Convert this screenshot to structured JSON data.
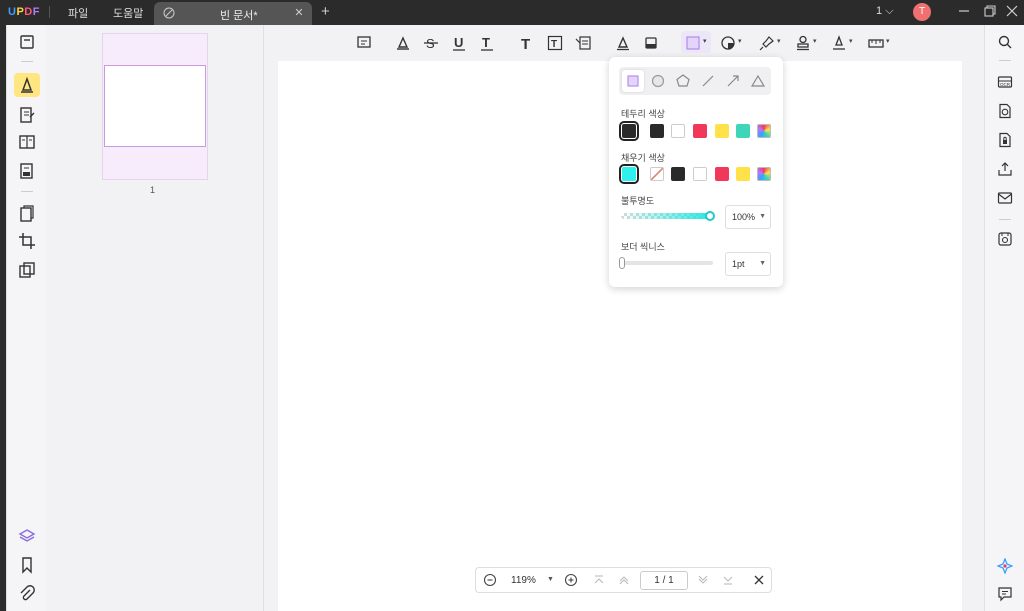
{
  "app": {
    "logo": "UPDF",
    "menus": [
      "파일",
      "도움말"
    ],
    "tab_title": "빈 문서*",
    "page_selector": "1",
    "avatar_letter": "T"
  },
  "thumbnails": {
    "page_number": "1"
  },
  "popup": {
    "shapes": [
      "rectangle",
      "circle",
      "pentagon",
      "line",
      "arrow",
      "triangle"
    ],
    "border_color_label": "테두리 색상",
    "border_colors": [
      "#2a2a2a",
      "#2a2a2a",
      "#ffffff",
      "#f2385a",
      "#ffe14a",
      "#3ed6b8",
      "rainbow"
    ],
    "fill_color_label": "채우기 색상",
    "fill_colors": [
      "#2ef0ec",
      "none",
      "#2a2a2a",
      "#ffffff",
      "#f2385a",
      "#ffe14a",
      "rainbow"
    ],
    "opacity_label": "불투명도",
    "opacity_value": "100%",
    "opacity_level": 1.0,
    "border_thickness_label": "보더 씩니스",
    "border_thickness_value": "1pt"
  },
  "navbar": {
    "zoom": "119%",
    "page_indicator": "1 / 1"
  },
  "colors": {
    "accent": "#b98ef0",
    "active_tool_bg": "#ffe680"
  }
}
